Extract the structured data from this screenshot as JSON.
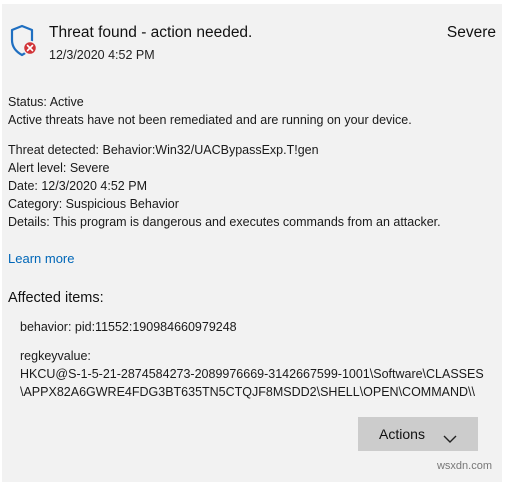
{
  "header": {
    "title": "Threat found - action needed.",
    "severity": "Severe",
    "timestamp": "12/3/2020 4:52 PM"
  },
  "status": {
    "line": "Status:  Active",
    "description": "Active threats have not been remediated and are running on your device."
  },
  "details": {
    "threat": "Threat detected:  Behavior:Win32/UACBypassExp.T!gen",
    "alert_level": "Alert level:  Severe",
    "date": "Date:  12/3/2020 4:52 PM",
    "category": "Category:  Suspicious Behavior",
    "details_text": "Details:  This program is dangerous and executes commands from an attacker."
  },
  "learn_more": "Learn more",
  "affected": {
    "heading": "Affected items:",
    "behavior": "behavior: pid:11552:190984660979248",
    "regkey_label": "regkeyvalue:",
    "regkey_line1": "HKCU@S-1-5-21-2874584273-2089976669-3142667599-1001\\Software\\CLASSES",
    "regkey_line2": "\\APPX82A6GWRE4FDG3BT635TN5CTQJF8MSDD2\\SHELL\\OPEN\\COMMAND\\\\"
  },
  "actions_label": "Actions",
  "watermark": "wsxdn.com",
  "colors": {
    "shield": "#1f6fc1",
    "alert_badge": "#d13438",
    "link": "#0067b8",
    "button_bg": "#cccccc",
    "panel_bg": "#f2f2f2"
  },
  "icons": {
    "shield": "shield-alert-icon",
    "chevron": "chevron-down-icon"
  }
}
